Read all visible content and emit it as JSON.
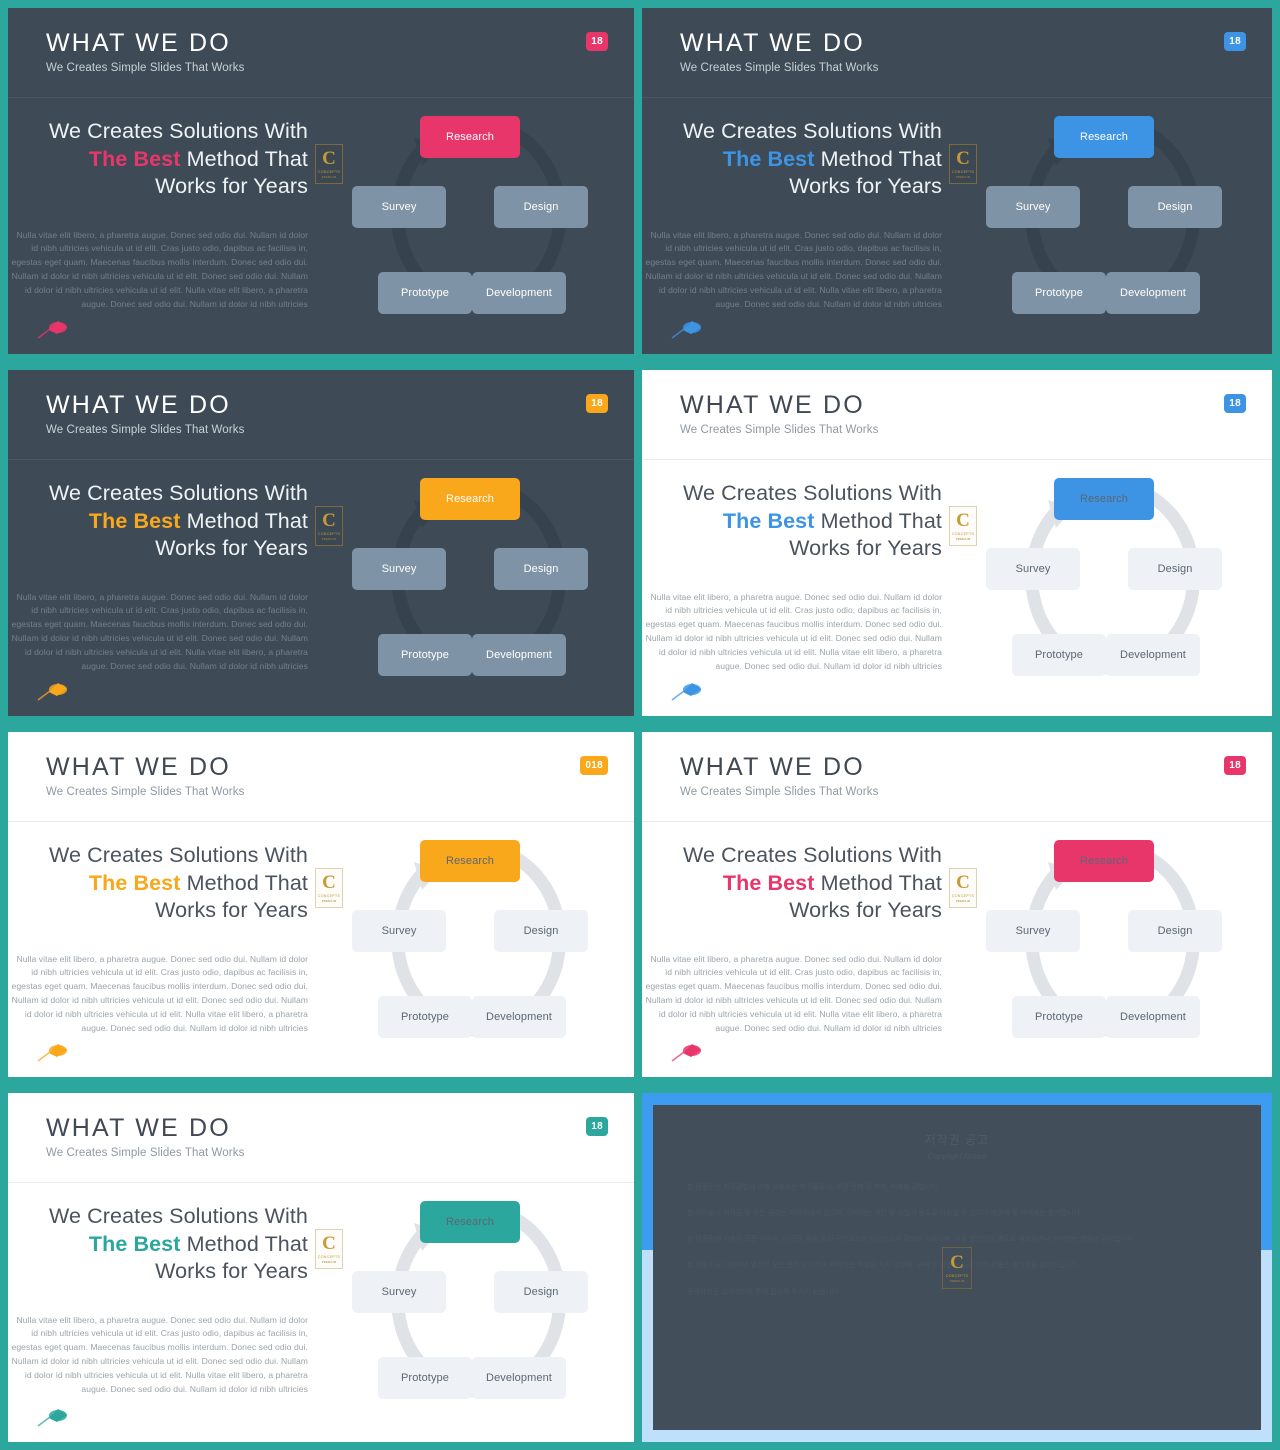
{
  "common": {
    "header_title": "WHAT WE DO",
    "header_subtitle": "We Creates Simple Slides That Works",
    "headline_line1": "We Creates Solutions With",
    "headline_bold": "The Best",
    "headline_line2_rest": " Method That",
    "headline_line3": "Works for Years",
    "paragraph": "Nulla vitae elit libero, a pharetra augue. Donec sed odio dui. Nullam id dolor id nibh ultricies vehicula ut id elit. Cras justo odio, dapibus ac facilisis in, egestas eget quam. Maecenas faucibus mollis interdum. Donec sed odio dui. Nullam id dolor id nibh ultricies vehicula ut id elit. Donec sed odio dui. Nullam id dolor id nibh ultricies vehicula ut id elit. Nulla vitae elit libero, a pharetra augue. Donec sed odio dui. Nullam id dolor id nibh ultricies",
    "logo_letter": "C",
    "logo_text_1": "CONCEPTS",
    "logo_text_2": "PREMIUM"
  },
  "nodes": {
    "research": "Research",
    "survey": "Survey",
    "design": "Design",
    "prototype": "Prototype",
    "development": "Development"
  },
  "colors": {
    "teal_border": "#2ba79e",
    "dark_bg": "#3e4b57",
    "pink": "#e8366b",
    "blue": "#3d94e5",
    "orange": "#f9a71b",
    "teal": "#2ba79e",
    "node_dark": "#7f93a6",
    "node_light": "#eef1f5",
    "ring_dark": "#36424d",
    "ring_light": "#dfe3e8",
    "gold": "#c79a35"
  },
  "slides": [
    {
      "id": "slide-1",
      "theme": "dark",
      "accent": "#e8366b",
      "badge": "18",
      "badge_color": "#e8366b",
      "pin_color": "#e8366b"
    },
    {
      "id": "slide-2",
      "theme": "dark",
      "accent": "#3d94e5",
      "badge": "18",
      "badge_color": "#3d94e5",
      "pin_color": "#3d94e5"
    },
    {
      "id": "slide-3",
      "theme": "dark",
      "accent": "#f9a71b",
      "badge": "18",
      "badge_color": "#f9a71b",
      "pin_color": "#f9a71b"
    },
    {
      "id": "slide-4",
      "theme": "light",
      "accent": "#3d94e5",
      "badge": "18",
      "badge_color": "#3d94e5",
      "pin_color": "#3d94e5"
    },
    {
      "id": "slide-5",
      "theme": "light",
      "accent": "#f9a71b",
      "badge": "018",
      "badge_color": "#f9a71b",
      "pin_color": "#f9a71b"
    },
    {
      "id": "slide-6",
      "theme": "light",
      "accent": "#e8366b",
      "badge": "18",
      "badge_color": "#e8366b",
      "pin_color": "#e8366b"
    },
    {
      "id": "slide-7",
      "theme": "light",
      "accent": "#2ba79e",
      "badge": "18",
      "badge_color": "#2ba79e",
      "pin_color": "#2ba79e"
    }
  ],
  "copyright_slide": {
    "title": "저작권 공고",
    "subtitle": "Copyright Notice",
    "paragraphs": [
      "본 템플릿은 저작권법에 의해 보호되는 저작물로서, 무단 전재 및 복제, 배포를 금합니다.",
      "본 저작물의 저작권 및 모든 권리는 제작자에게 있으며, 구매자는 개인 및 상업적 용도로 사용할 수 있으나 재판매 및 재배포는 불가합니다.",
      "본 템플릿에 사용된 모든 이미지, 아이콘, 폰트 등의 구성요소는 라이선스가 확보된 자료이며, 이를 분리하여 별도로 배포하거나 판매하는 행위는 금지됩니다.",
      "본 템플릿을 이용하여 발생한 모든 문제에 대하여 제작자는 책임을 지지 않으며, 구매 후 단순 변심에 의한 환불은 불가함을 알려드립니다.",
      "문의사항은 고객센터를 통해 접수해 주시기 바랍니다."
    ],
    "logo_letter": "C",
    "logo_text_1": "CONCEPTS",
    "logo_text_2": "PREMIUM"
  }
}
